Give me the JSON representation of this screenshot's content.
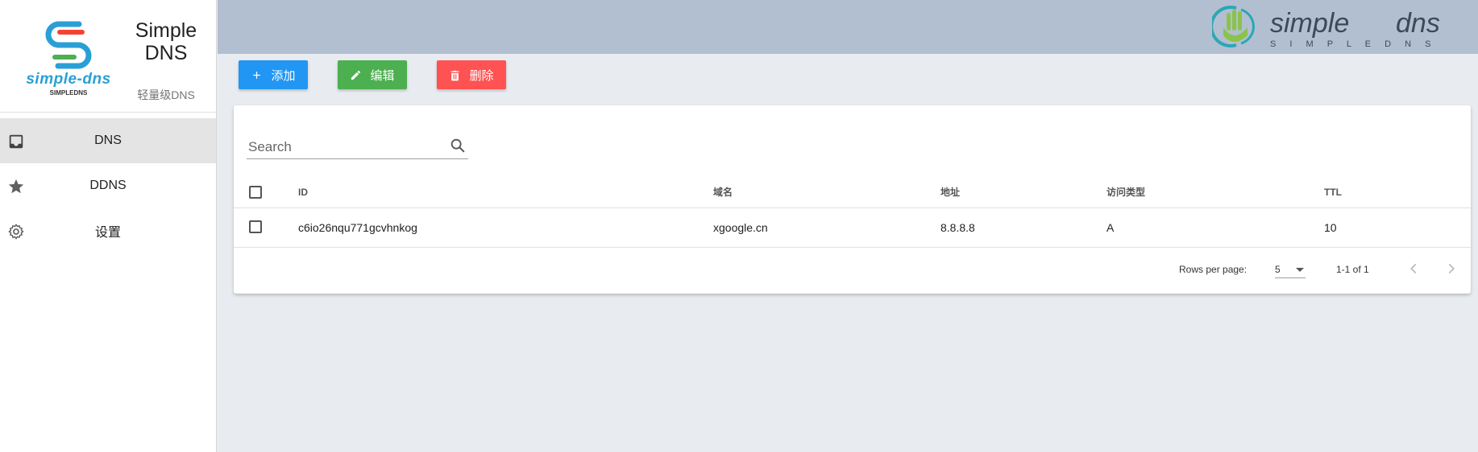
{
  "brand": {
    "logo_text": "simple-dns",
    "logo_sub": "SIMPLEDNS",
    "title": "Simple DNS",
    "subtitle": "轻量级DNS"
  },
  "nav": {
    "items": [
      {
        "label": "DNS",
        "icon": "inbox-icon",
        "active": true
      },
      {
        "label": "DDNS",
        "icon": "star-icon",
        "active": false
      },
      {
        "label": "设置",
        "icon": "gear-icon",
        "active": false
      }
    ]
  },
  "header": {
    "logo_word1": "simple",
    "logo_word2": "dns",
    "logo_tagline": "S I M P L E   D N S"
  },
  "toolbar": {
    "add_label": "添加",
    "edit_label": "编辑",
    "delete_label": "删除"
  },
  "search": {
    "placeholder": "Search"
  },
  "table": {
    "columns": [
      "ID",
      "域名",
      "地址",
      "访问类型",
      "TTL"
    ],
    "rows": [
      {
        "id": "c6io26nqu771gcvhnkog",
        "domain": "xgoogle.cn",
        "address": "8.8.8.8",
        "type": "A",
        "ttl": "10"
      }
    ]
  },
  "pagination": {
    "rows_per_page_label": "Rows per page:",
    "rows_per_page": "5",
    "range": "1-1 of 1"
  },
  "colors": {
    "add": "#2196f3",
    "edit": "#4caf50",
    "delete": "#ff5252",
    "topbar": "#b2bfd1",
    "logo_blue": "#2a9fd6",
    "brand_teal": "#2aa7b5",
    "brand_green": "#8bc34a"
  }
}
